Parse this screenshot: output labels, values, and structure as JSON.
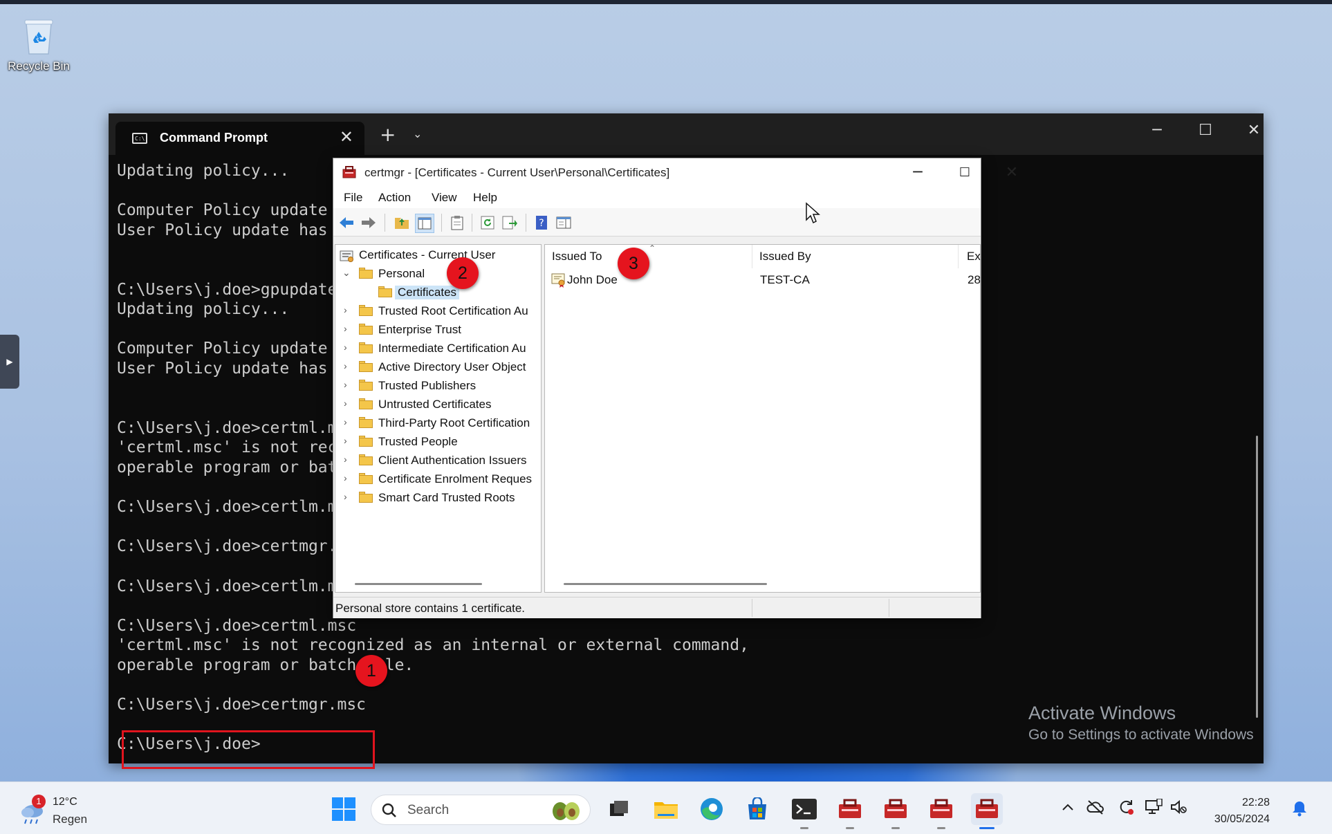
{
  "desktop": {
    "recycle_bin_label": "Recycle Bin",
    "watermark_line1": "Activate Windows",
    "watermark_line2": "Go to Settings to activate Windows"
  },
  "terminal": {
    "tab_title": "Command Prompt",
    "lines": [
      "Updating policy...",
      "",
      "Computer Policy update",
      "User Policy update has",
      "",
      "",
      "C:\\Users\\j.doe>gpupdate",
      "Updating policy...",
      "",
      "Computer Policy update",
      "User Policy update has",
      "",
      "",
      "C:\\Users\\j.doe>certml.m",
      "'certml.msc' is not rec",
      "operable program or bat",
      "",
      "C:\\Users\\j.doe>certlm.m",
      "",
      "C:\\Users\\j.doe>certmgr.",
      "",
      "C:\\Users\\j.doe>certlm.m",
      "",
      "C:\\Users\\j.doe>certml.msc",
      "'certml.msc' is not recognized as an internal or external command,",
      "operable program or batch file.",
      "",
      "C:\\Users\\j.doe>certmgr.msc",
      "",
      "C:\\Users\\j.doe>"
    ]
  },
  "markers": {
    "m1": "1",
    "m2": "2",
    "m3": "3"
  },
  "certmgr": {
    "title": "certmgr - [Certificates - Current User\\Personal\\Certificates]",
    "menu": [
      "File",
      "Action",
      "View",
      "Help"
    ],
    "tree": {
      "root": "Certificates - Current User",
      "personal": "Personal",
      "certificates": "Certificates",
      "stores": [
        "Trusted Root Certification Au",
        "Enterprise Trust",
        "Intermediate Certification Au",
        "Active Directory User Object",
        "Trusted Publishers",
        "Untrusted Certificates",
        "Third-Party Root Certification",
        "Trusted People",
        "Client Authentication Issuers",
        "Certificate Enrolment Reques",
        "Smart Card Trusted Roots"
      ]
    },
    "columns": [
      "Issued To",
      "Issued By",
      "Ex"
    ],
    "rows": [
      {
        "issued_to": "John Doe",
        "issued_by": "TEST-CA",
        "expiry": "28"
      }
    ],
    "status": "Personal store contains 1 certificate."
  },
  "taskbar": {
    "weather_temp": "12°C",
    "weather_cond": "Regen",
    "weather_badge": "1",
    "search_placeholder": "Search",
    "time": "22:28",
    "date": "30/05/2024"
  },
  "colors": {
    "marker": "#e5141e",
    "highlight_box": "#e0141e",
    "terminal_bg": "#0c0c0c",
    "accent": "#1f6feb"
  }
}
